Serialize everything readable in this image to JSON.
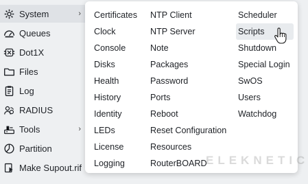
{
  "sidebar": {
    "items": [
      {
        "label": "System",
        "icon": "gear-icon",
        "has_submenu": true
      },
      {
        "label": "Queues",
        "icon": "queues-icon",
        "has_submenu": false
      },
      {
        "label": "Dot1X",
        "icon": "dot1x-icon",
        "has_submenu": false
      },
      {
        "label": "Files",
        "icon": "folder-icon",
        "has_submenu": false
      },
      {
        "label": "Log",
        "icon": "log-icon",
        "has_submenu": false
      },
      {
        "label": "RADIUS",
        "icon": "radius-icon",
        "has_submenu": false
      },
      {
        "label": "Tools",
        "icon": "tools-icon",
        "has_submenu": true
      },
      {
        "label": "Partition",
        "icon": "partition-icon",
        "has_submenu": false
      },
      {
        "label": "Make Supout.rif",
        "icon": "supout-icon",
        "has_submenu": false
      }
    ],
    "arrow_glyph": "›"
  },
  "submenu": {
    "col1": [
      "Certificates",
      "Clock",
      "Console",
      "Disks",
      "Health",
      "History",
      "Identity",
      "LEDs",
      "License",
      "Logging"
    ],
    "col2": [
      "NTP Client",
      "NTP Server",
      "Note",
      "Packages",
      "Password",
      "Ports",
      "Reboot",
      "Reset Configuration",
      "Resources",
      "RouterBOARD"
    ],
    "col3": [
      "Scheduler",
      "Scripts",
      "Shutdown",
      "Special Login",
      "SwOS",
      "Users",
      "Watchdog"
    ],
    "hovered": "Scripts"
  },
  "watermark": "ELEKNETIC",
  "colors": {
    "background": "#eef0f2",
    "menu": "#ffffff",
    "hover": "#e8ebee",
    "icon": "#1e2126"
  }
}
